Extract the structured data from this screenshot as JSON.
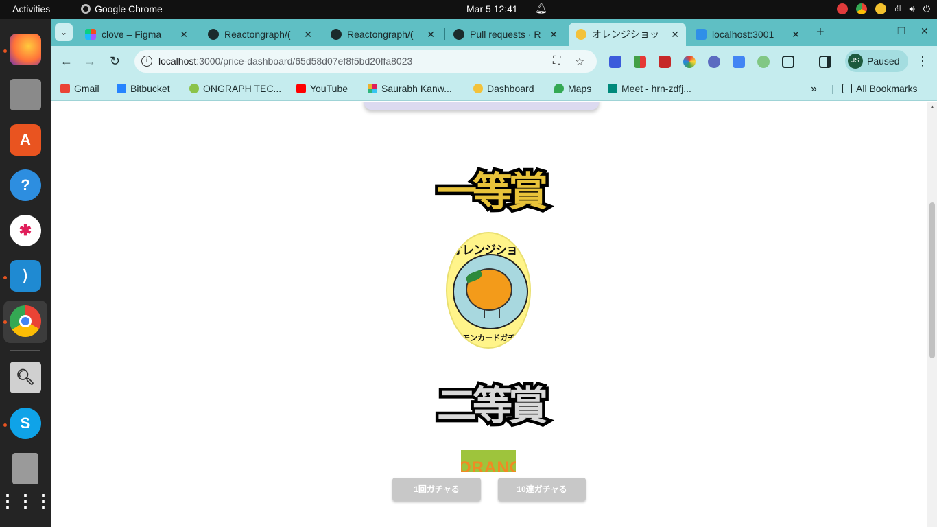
{
  "topbar": {
    "activities": "Activities",
    "app_name": "Google Chrome",
    "clock": "Mar 5  12:41"
  },
  "dock": {
    "apps": [
      "firefox-icon",
      "files-icon",
      "app-center-icon",
      "help-icon",
      "slack-icon",
      "vscode-icon",
      "chrome-icon",
      "image-viewer-icon",
      "skype-icon",
      "trash-icon",
      "show-apps-icon"
    ]
  },
  "tabs": [
    {
      "title": "clove – Figma",
      "active": false
    },
    {
      "title": "Reactongraph/(",
      "active": false
    },
    {
      "title": "Reactongraph/(",
      "active": false
    },
    {
      "title": "Pull requests · R",
      "active": false
    },
    {
      "title": "オレンジショッ",
      "active": true
    },
    {
      "title": "localhost:3001",
      "active": false
    }
  ],
  "omnibox": {
    "url_host": "localhost",
    "url_path": ":3000/price-dashboard/65d58d07ef8f5bd20ffa8023"
  },
  "profile": {
    "initials": "JS",
    "status": "Paused"
  },
  "bookmarks": [
    {
      "label": "Gmail"
    },
    {
      "label": "Bitbucket"
    },
    {
      "label": "ONGRAPH TEC..."
    },
    {
      "label": "YouTube"
    },
    {
      "label": "Saurabh Kanw..."
    },
    {
      "label": "Dashboard"
    },
    {
      "label": "Maps"
    },
    {
      "label": "Meet - hrn-zdfj..."
    }
  ],
  "all_bookmarks": "All Bookmarks",
  "page": {
    "first_prize": "一等賞",
    "second_prize": "二等賞",
    "logo_top_text": "オレンジショップ",
    "logo_bottom_text": "ポケモンカードガチャ専門",
    "partial_image_text": "ORANG",
    "btn_single": "1回ガチャる",
    "btn_ten": "10連ガチャる"
  }
}
